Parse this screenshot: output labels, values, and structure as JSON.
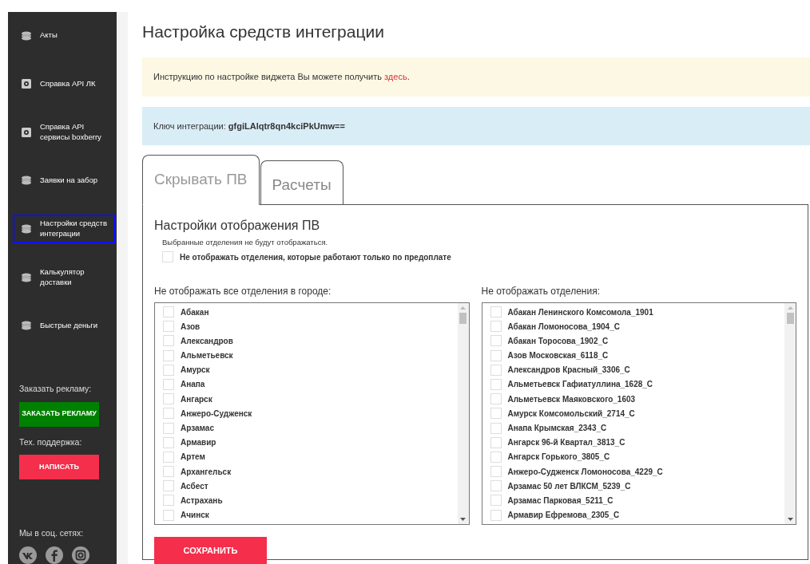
{
  "sidebar": {
    "items": [
      {
        "label": "Акты",
        "kind": "stack",
        "selected": false
      },
      {
        "label": "Справка API ЛК",
        "kind": "gear",
        "selected": false
      },
      {
        "label": "Справка API сервисы boxberry",
        "kind": "gear",
        "selected": false
      },
      {
        "label": "Заявки на забор",
        "kind": "stack",
        "selected": false
      },
      {
        "label": "Настройки средств интеграции",
        "kind": "stack",
        "selected": true
      },
      {
        "label": "Калькулятор доставки",
        "kind": "stack",
        "selected": false
      },
      {
        "label": "Быстрые деньги",
        "kind": "stack",
        "selected": false
      }
    ],
    "ad_label": "Заказать рекламу:",
    "ad_button": "ЗАКАЗАТЬ РЕКЛАМУ",
    "support_label": "Тех. поддержка:",
    "support_button": "НАПИСАТЬ",
    "social_label": "Мы в соц. сетях:",
    "social": [
      {
        "kind": "vk"
      },
      {
        "kind": "facebook"
      },
      {
        "kind": "instagram"
      }
    ]
  },
  "page_title": "Настройка средств интеграции",
  "instruction": {
    "text": "Инструкцию по настройке виджета Вы можете получить ",
    "link": "здесь",
    "after": "."
  },
  "key": {
    "label": "Ключ интеграции:",
    "value": "gfgiLAlqtr8qn4kciPkUmw=="
  },
  "tabs": [
    {
      "label": "Скрывать ПВ",
      "selected": true
    },
    {
      "label": "Расчеты",
      "selected": false
    }
  ],
  "panel": {
    "title": "Настройки отображения ПВ",
    "hint": "Выбранные отделения не будут отображаться.",
    "prepay": {
      "label": "Не отображать отделения, которые работают только по предоплате",
      "checked": false
    },
    "cities": {
      "label": "Не отображать все отделения в городе:",
      "items": [
        {
          "label": "Абакан",
          "checked": false
        },
        {
          "label": "Азов",
          "checked": false
        },
        {
          "label": "Александров",
          "checked": false
        },
        {
          "label": "Альметьевск",
          "checked": false
        },
        {
          "label": "Амурск",
          "checked": false
        },
        {
          "label": "Анапа",
          "checked": false
        },
        {
          "label": "Ангарск",
          "checked": false
        },
        {
          "label": "Анжеро-Судженск",
          "checked": false
        },
        {
          "label": "Арзамас",
          "checked": false
        },
        {
          "label": "Армавир",
          "checked": false
        },
        {
          "label": "Артем",
          "checked": false
        },
        {
          "label": "Архангельск",
          "checked": false
        },
        {
          "label": "Асбест",
          "checked": false
        },
        {
          "label": "Астрахань",
          "checked": false
        },
        {
          "label": "Ачинск",
          "checked": false
        }
      ]
    },
    "offices": {
      "label": "Не отображать отделения:",
      "items": [
        {
          "label": "Абакан Ленинского Комсомола_1901",
          "checked": false
        },
        {
          "label": "Абакан Ломоносова_1904_С",
          "checked": false
        },
        {
          "label": "Абакан Торосова_1902_С",
          "checked": false
        },
        {
          "label": "Азов Московская_6118_С",
          "checked": false
        },
        {
          "label": "Александров Красный_3306_С",
          "checked": false
        },
        {
          "label": "Альметьевск Гафиатуллина_1628_С",
          "checked": false
        },
        {
          "label": "Альметьевск Маяковского_1603",
          "checked": false
        },
        {
          "label": "Амурск Комсомольский_2714_С",
          "checked": false
        },
        {
          "label": "Анапа Крымская_2343_С",
          "checked": false
        },
        {
          "label": "Ангарск 96-й Квартал_3813_С",
          "checked": false
        },
        {
          "label": "Ангарск Горького_3805_С",
          "checked": false
        },
        {
          "label": "Анжеро-Судженск Ломоносова_4229_С",
          "checked": false
        },
        {
          "label": "Арзамас 50 лет ВЛКСМ_5239_С",
          "checked": false
        },
        {
          "label": "Арзамас Парковая_5211_С",
          "checked": false
        },
        {
          "label": "Армавир Ефремова_2305_С",
          "checked": false
        }
      ]
    },
    "save_button": "СОХРАНИТЬ"
  }
}
